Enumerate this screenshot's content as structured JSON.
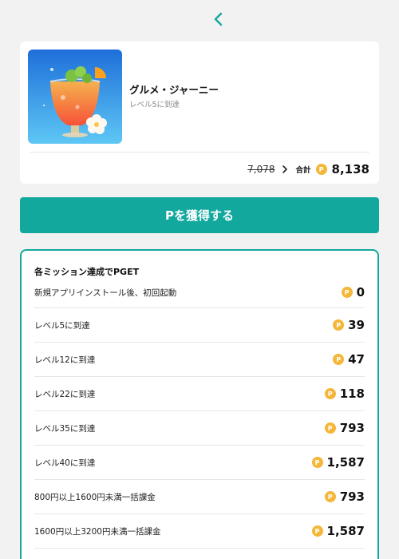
{
  "colors": {
    "accent": "#13a89e",
    "coin": "#f4b73a",
    "background": "#f2f2f2"
  },
  "nav": {
    "back_icon": "chevron-left-icon"
  },
  "app": {
    "name": "グルメ・ジャーニー",
    "subtitle": "レベル5に到達",
    "old_price": "7,078",
    "total_label": "合計",
    "total_value": "8,138",
    "coin_symbol": "P"
  },
  "cta": {
    "label": "Pを獲得する"
  },
  "missions": {
    "title": "各ミッション達成でPGET",
    "items": [
      {
        "label": "新規アプリインストール後、初回起動",
        "points": "0"
      },
      {
        "label": "レベル5に到達",
        "points": "39"
      },
      {
        "label": "レベル12に到達",
        "points": "47"
      },
      {
        "label": "レベル22に到達",
        "points": "118"
      },
      {
        "label": "レベル35に到達",
        "points": "793"
      },
      {
        "label": "レベル40に到達",
        "points": "1,587"
      },
      {
        "label": "800円以上1600円未満一括課金",
        "points": "793"
      },
      {
        "label": "1600円以上3200円未満一括課金",
        "points": "1,587"
      }
    ]
  }
}
